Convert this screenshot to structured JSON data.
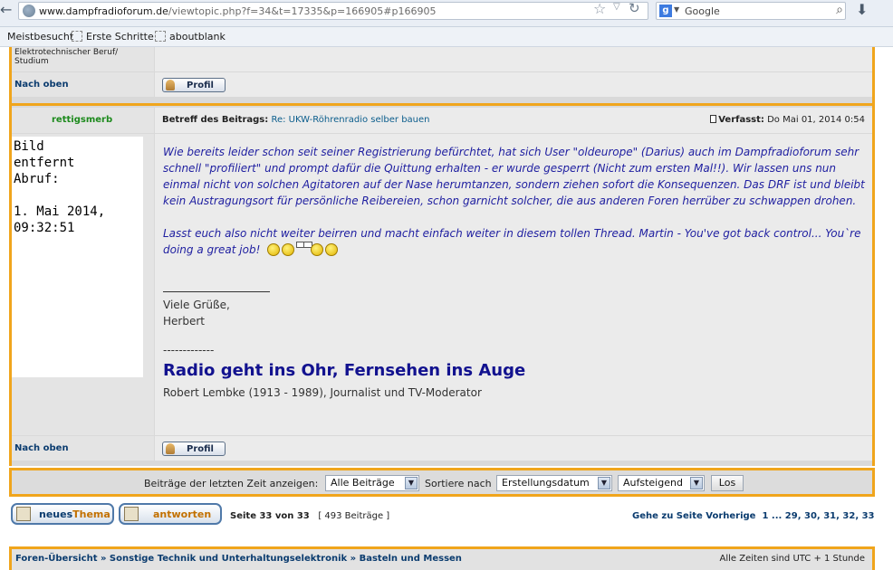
{
  "browser": {
    "url_host": "www.dampfradioforum.de",
    "url_path": "/viewtopic.php?f=34&t=17335&p=166905#p166905",
    "search_engine": "Google",
    "bookmarks": [
      "Meistbesucht",
      "Erste Schritte",
      "aboutblank"
    ]
  },
  "prev_post": {
    "author_info": "Elektrotechnischer Beruf/ Studium",
    "back_to_top": "Nach oben",
    "profile_label": "Profil"
  },
  "post": {
    "author": "rettigsmerb",
    "subject_label": "Betreff des Beitrags:",
    "subject": "Re: UKW-Röhrenradio selber bauen",
    "posted_label": "Verfasst:",
    "posted_date": "Do Mai 01, 2014 0:54",
    "avatar_text": "Bild\nentfernt\nAbruf:\n\n1. Mai 2014,\n09:32:51",
    "body_p1": "Wie bereits leider schon seit seiner Registrierung befürchtet, hat sich User \"oldeurope\" (Darius) auch im Dampfradioforum sehr schnell \"profiliert\" und prompt dafür die Quittung erhalten - er wurde gesperrt (Nicht zum ersten Mal!!). Wir lassen uns nun einmal nicht von solchen Agitatoren auf der Nase herumtanzen, sondern ziehen sofort die Konsequenzen. Das DRF ist und bleibt kein Austragungsort für persönliche Reibereien, schon garnicht solcher, die aus anderen Foren herrüber zu schwappen drohen.",
    "body_p2": "Lasst euch also nicht weiter beirren und macht einfach weiter in diesem tollen Thread. Martin - You've got back control... You`re doing a great job!",
    "greeting": "Viele Grüße,",
    "signature_name": "Herbert",
    "sig_dashes": "-------------",
    "sig_quote": "Radio geht ins Ohr, Fernsehen ins Auge",
    "sig_author": "Robert Lembke (1913 - 1989), Journalist und TV-Moderator",
    "back_to_top": "Nach oben",
    "profile_label": "Profil"
  },
  "sort_bar": {
    "show_label": "Beiträge der letzten Zeit anzeigen:",
    "show_value": "Alle Beiträge",
    "sort_label": "Sortiere nach",
    "sort_value": "Erstellungsdatum",
    "order_value": "Aufsteigend",
    "go_label": "Los"
  },
  "actions": {
    "new_topic_a": "neues",
    "new_topic_b": "Thema",
    "reply": "antworten",
    "page_info": "Seite 33 von 33",
    "post_count": "[ 493 Beiträge ]",
    "goto_label": "Gehe zu Seite",
    "prev_label": "Vorherige",
    "pages": [
      "1",
      "...",
      "29",
      "30",
      "31",
      "32",
      "33"
    ]
  },
  "breadcrumbs": {
    "items": [
      "Foren-Übersicht",
      "Sonstige Technik und Unterhaltungselektronik",
      "Basteln und Messen"
    ],
    "separator": "»",
    "timezone": "Alle Zeiten sind UTC + 1 Stunde"
  }
}
